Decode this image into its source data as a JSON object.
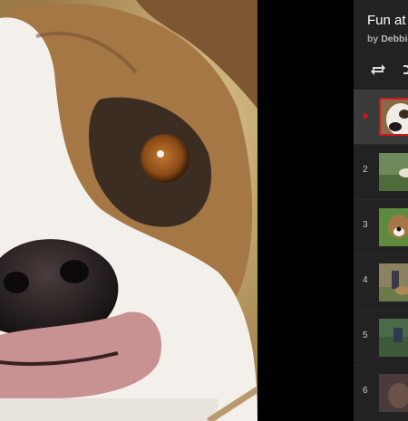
{
  "playlist": {
    "title": "Fun at",
    "by_prefix": "by",
    "owner": "Debbie",
    "controls": {
      "loop_icon": "loop-icon",
      "shuffle_icon": "shuffle-icon"
    },
    "items": [
      {
        "index": "",
        "active": true
      },
      {
        "index": "2",
        "active": false
      },
      {
        "index": "3",
        "active": false
      },
      {
        "index": "4",
        "active": false
      },
      {
        "index": "5",
        "active": false
      },
      {
        "index": "6",
        "active": false
      }
    ]
  },
  "colors": {
    "panel": "#222222",
    "active_row": "#3a3a3a",
    "accent": "#cc181e"
  }
}
